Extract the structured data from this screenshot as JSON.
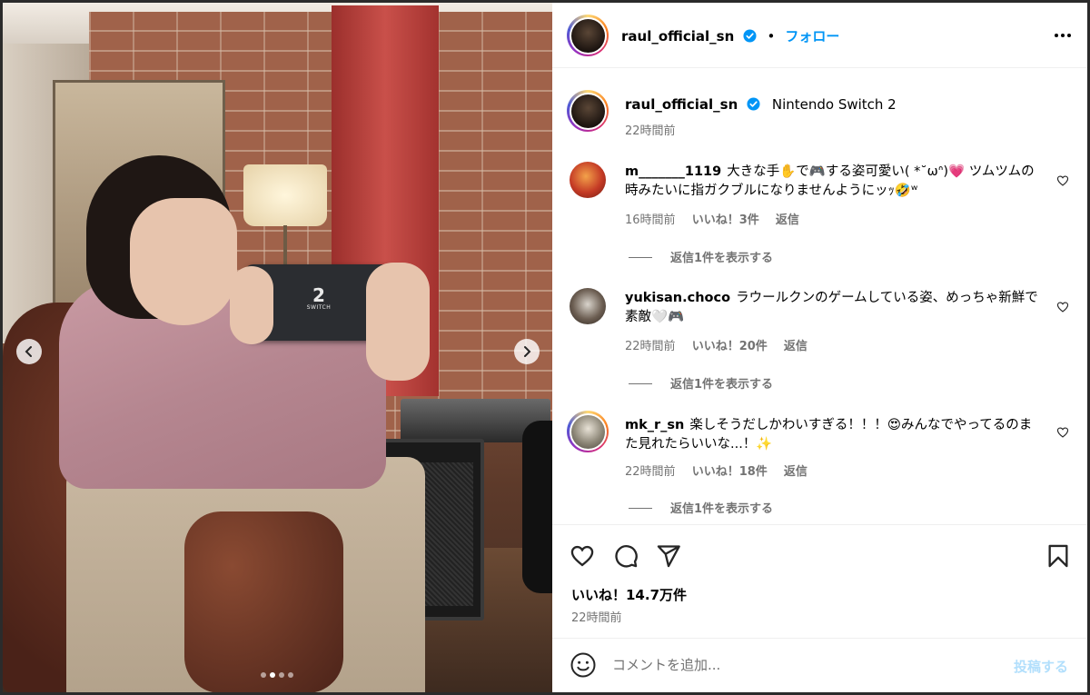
{
  "post": {
    "username": "raul_official_sn",
    "separator": "•",
    "follow_label": "フォロー",
    "caption_text": "Nintendo Switch 2",
    "caption_time": "22時間前"
  },
  "photo": {
    "switch_logo_big": "2",
    "switch_logo_small": "SWITCH",
    "carousel_dots": 4,
    "active_dot": 2
  },
  "comments": [
    {
      "username": "m_______1119",
      "text": "大きな手✋で🎮する姿可愛い( *˘ωᐢ)💗 ツムツムの時みたいに指ガクブルになりませんようにッｯ🤣ʷ",
      "time": "16時間前",
      "likes": "いいね！3件",
      "reply": "返信",
      "view_replies": "返信1件を表示する"
    },
    {
      "username": "yukisan.choco",
      "text": "ラウールクンのゲームしている姿、めっちゃ新鮮で素敵🤍🎮",
      "time": "22時間前",
      "likes": "いいね！20件",
      "reply": "返信",
      "view_replies": "返信1件を表示する"
    },
    {
      "username": "mk_r_sn",
      "text": "楽しそうだしかわいすぎる！！！😍みんなでやってるのまた見れたらいいな...！✨",
      "time": "22時間前",
      "likes": "いいね！18件",
      "reply": "返信",
      "view_replies": "返信1件を表示する"
    }
  ],
  "actions": {
    "likes": "いいね！14.7万件",
    "time": "22時間前"
  },
  "comment_box": {
    "placeholder": "コメントを追加...",
    "post_label": "投稿する"
  },
  "colors": {
    "link_blue": "#0095f6",
    "muted": "#737373",
    "disabled_post": "#b2dffc",
    "verified": "#0095f6"
  },
  "icons": [
    "verified-badge-icon",
    "more-options-icon",
    "heart-icon",
    "comment-icon",
    "share-icon",
    "bookmark-icon",
    "emoji-icon",
    "chevron-left-icon",
    "chevron-right-icon"
  ]
}
